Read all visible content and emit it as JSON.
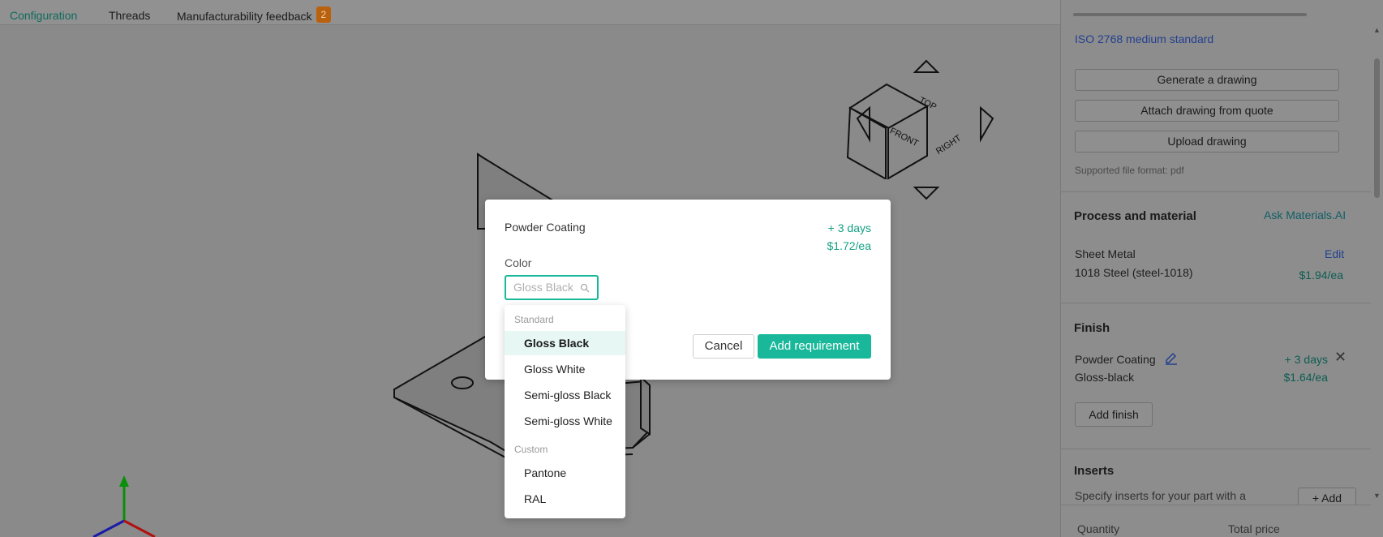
{
  "tabs": {
    "configuration": "Configuration",
    "threads": "Threads",
    "manufacturability": "Manufacturability feedback",
    "manufacturability_badge": "2"
  },
  "viewer": {
    "cube_faces": {
      "top": "TOP",
      "front": "FRONT",
      "right": "RIGHT"
    }
  },
  "panel": {
    "iso_link": "ISO 2768 medium standard",
    "buttons": {
      "generate": "Generate a drawing",
      "attach": "Attach drawing from quote",
      "upload": "Upload drawing"
    },
    "supported_format": "Supported file format:  pdf",
    "process": {
      "heading": "Process and material",
      "ask_link": "Ask Materials.AI",
      "process_name": "Sheet Metal",
      "edit_link": "Edit",
      "material": "1018 Steel (steel-1018)",
      "price": "$1.94/ea"
    },
    "finish": {
      "heading": "Finish",
      "name": "Powder Coating",
      "days": "+ 3 days",
      "color": "Gloss-black",
      "price": "$1.64/ea",
      "add_button": "Add finish"
    },
    "inserts": {
      "heading": "Inserts",
      "description": "Specify inserts for your part with a",
      "add_button": "+  Add"
    },
    "footer": {
      "quantity": "Quantity",
      "total_price": "Total price"
    }
  },
  "modal": {
    "title": "Powder Coating",
    "days": "+ 3 days",
    "price": "$1.72/ea",
    "color_label": "Color",
    "color_placeholder": "Gloss Black",
    "cancel": "Cancel",
    "add": "Add requirement"
  },
  "dropdown": {
    "groups": [
      {
        "label": "Standard",
        "items": [
          "Gloss Black",
          "Gloss White",
          "Semi-gloss Black",
          "Semi-gloss White"
        ]
      },
      {
        "label": "Custom",
        "items": [
          "Pantone",
          "RAL"
        ]
      }
    ],
    "selected": "Gloss Black"
  },
  "colors": {
    "accent": "#19b89a",
    "accent_text": "#14a184",
    "badge": "#b9610c",
    "link": "#23408f"
  }
}
